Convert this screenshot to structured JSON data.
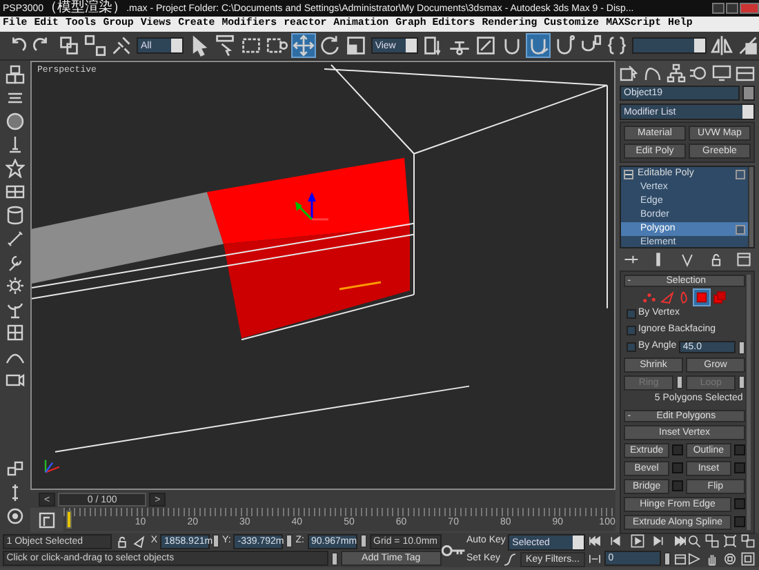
{
  "window": {
    "title": "PSP3000（模型渲染）.max   - Project Folder: C:\\Documents and Settings\\Administrator\\My Documents\\3dsmax   - Autodesk 3ds Max 9   - Disp..."
  },
  "menu": [
    "File",
    "Edit",
    "Tools",
    "Group",
    "Views",
    "Create",
    "Modifiers",
    "reactor",
    "Animation",
    "Graph Editors",
    "Rendering",
    "Customize",
    "MAXScript",
    "Help"
  ],
  "toolbar": [
    {
      "kind": "icon",
      "selected": false
    },
    {
      "kind": "icon",
      "selected": false
    },
    {
      "kind": "icon",
      "selected": false
    },
    {
      "kind": "icon",
      "selected": false
    },
    {
      "kind": "icon",
      "selected": false
    },
    {
      "kind": "dropdown",
      "value": "All"
    },
    {
      "kind": "icon",
      "selected": false
    },
    {
      "kind": "icon",
      "selected": false
    },
    {
      "kind": "icon",
      "selected": false
    },
    {
      "kind": "icon",
      "selected": false
    },
    {
      "kind": "icon",
      "selected": true
    },
    {
      "kind": "icon",
      "selected": false
    },
    {
      "kind": "icon",
      "selected": false
    },
    {
      "kind": "dropdown",
      "value": "View"
    },
    {
      "kind": "icon",
      "selected": false
    },
    {
      "kind": "icon",
      "selected": false
    },
    {
      "kind": "icon",
      "selected": false
    },
    {
      "kind": "icon",
      "selected": false
    },
    {
      "kind": "icon",
      "selected": true
    },
    {
      "kind": "icon",
      "selected": false
    },
    {
      "kind": "icon",
      "selected": false
    },
    {
      "kind": "icon",
      "selected": false
    },
    {
      "kind": "dropdown"
    },
    {
      "kind": "icon",
      "selected": false
    },
    {
      "kind": "icon",
      "selected": false
    }
  ],
  "viewport": {
    "label": "Perspective"
  },
  "time_slider": {
    "prev": "<",
    "reading": "0 / 100",
    "next": ">"
  },
  "ruler_labels": [
    "10",
    "20",
    "30",
    "40",
    "50",
    "60",
    "70",
    "80",
    "90",
    "100"
  ],
  "command_panel": {
    "object_name": "Object19",
    "modifier_list": "Modifier List",
    "modifier_buttons": [
      "Material",
      "UVW Map",
      "Edit Poly",
      "Greeble"
    ],
    "stack": {
      "label": "Editable Poly",
      "expanded": true,
      "children": [
        {
          "label": "Vertex",
          "selected": false
        },
        {
          "label": "Edge",
          "selected": false
        },
        {
          "label": "Border",
          "selected": false
        },
        {
          "label": "Polygon",
          "selected": true
        },
        {
          "label": "Element",
          "selected": false
        }
      ]
    },
    "selection": {
      "collapse": "-",
      "title": "Selection",
      "levels": [
        {
          "selected": false
        },
        {
          "selected": false
        },
        {
          "selected": false
        },
        {
          "selected": true
        },
        {
          "selected": false
        }
      ],
      "options": [
        {
          "label": "By Vertex",
          "checked": false
        },
        {
          "label": "Ignore Backfacing",
          "checked": false
        },
        {
          "label": "By Angle",
          "checked": false,
          "value": "45.0"
        }
      ],
      "buttons": [
        {
          "kind": "plain",
          "label": "Shrink",
          "disabled": false
        },
        {
          "kind": "plain",
          "label": "Grow",
          "disabled": false
        },
        {
          "kind": "spinner",
          "label": "Ring",
          "disabled": true
        },
        {
          "kind": "spinner",
          "label": "Loop",
          "disabled": true
        }
      ],
      "summary": "5 Polygons Selected"
    },
    "edit_polygons": {
      "collapse": "-",
      "title": "Edit Polygons",
      "rows": [
        {
          "buttons": [
            {
              "label": "Inset Vertex",
              "settings": false
            }
          ]
        },
        {
          "buttons": [
            {
              "label": "Extrude",
              "settings": true
            },
            {
              "label": "Outline",
              "settings": true
            }
          ]
        },
        {
          "buttons": [
            {
              "label": "Bevel",
              "settings": true
            },
            {
              "label": "Inset",
              "settings": true
            }
          ]
        },
        {
          "buttons": [
            {
              "label": "Bridge",
              "settings": true
            },
            {
              "label": "Flip",
              "settings": false
            }
          ]
        },
        {
          "buttons": [
            {
              "label": "Hinge From Edge",
              "settings": true
            }
          ]
        },
        {
          "buttons": [
            {
              "label": "Extrude Along Spline",
              "settings": true
            }
          ]
        }
      ]
    }
  },
  "status": {
    "selection": "1 Object Selected",
    "x_label": "X",
    "x": "1858.921m",
    "y_label": "Y:",
    "y": "-339.792m",
    "z_label": "Z:",
    "z": "90.967mm",
    "grid": "Grid = 10.0mm",
    "prompt": "Click or click-and-drag to select objects",
    "time_tag": "Add Time Tag"
  },
  "animation": {
    "auto_key": "Auto Key",
    "key_mode": "Selected",
    "set_key": "Set Key",
    "key_filters": "Key Filters...",
    "frame": "0"
  }
}
